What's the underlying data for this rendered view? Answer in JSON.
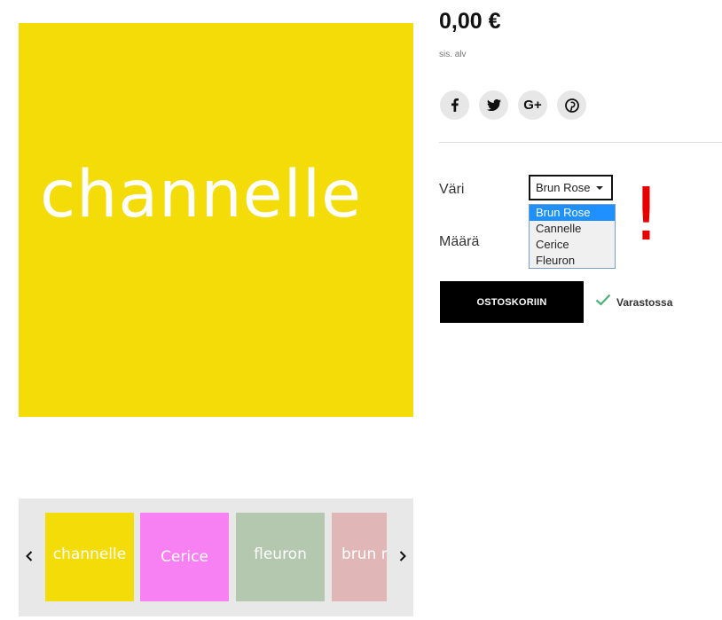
{
  "product": {
    "main_image_text": "channelle",
    "main_image_color": "#f3dc08",
    "price": "0,00 €",
    "vat_note": "sis. alv"
  },
  "share": {
    "icons": [
      "facebook-icon",
      "twitter-icon",
      "google-plus-icon",
      "pinterest-icon"
    ],
    "google_plus_label": "G+"
  },
  "options": {
    "color_label": "Väri",
    "color_selected": "Brun Rose",
    "color_options": [
      "Brun Rose",
      "Cannelle",
      "Cerice",
      "Fleuron"
    ],
    "quantity_label": "Määrä"
  },
  "annotation": {
    "mark": "!",
    "color": "#e60000"
  },
  "cart": {
    "button_label": "OSTOSKORIIN",
    "stock_label": "Varastossa",
    "stock_color": "#4caf78"
  },
  "thumbnails": [
    {
      "label": "channelle",
      "color": "#f3dc08"
    },
    {
      "label": "Cerice",
      "color": "#f781f3"
    },
    {
      "label": "fleuron",
      "color": "#b3c8ae"
    },
    {
      "label": "brun rose",
      "color": "#e0b6b7"
    }
  ],
  "carousel": {
    "prev_icon": "chevron-left-icon",
    "next_icon": "chevron-right-icon"
  }
}
